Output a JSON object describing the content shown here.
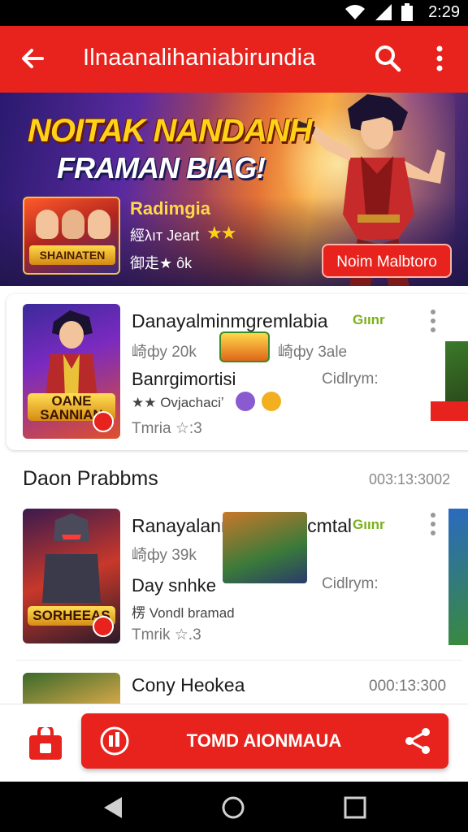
{
  "status_bar": {
    "time": "2:29",
    "icons": [
      "wifi-icon",
      "signal-icon",
      "battery-icon"
    ]
  },
  "app_bar": {
    "title": "Ilnaanalihaniabirundia",
    "icons": [
      "back-arrow-icon",
      "search-icon",
      "more-vert-icon"
    ]
  },
  "hero": {
    "headline_line1": "NOITAK NANDANH",
    "headline_line2": "FRAMAN BIAG!",
    "thumb_logo": "SHAINATEN",
    "game_name": "Radimgia",
    "meta": "經λıт Jeart",
    "stars": "★★",
    "sub": "御走★ ôk",
    "cta_label": "Noim Malbtoro"
  },
  "cards": [
    {
      "title": "Danayalminmgremlabia",
      "tag": "Gıınr",
      "meta_left": "崎фу  20k",
      "meta_right": "崎фу  3ale",
      "sub": "Banrgimortisi",
      "sub_right": "Cidlrym:",
      "small": "★★ Ovjachaciʼ",
      "tiny": "Tmria  ☆:3",
      "thumb_logo_line1": "OANE",
      "thumb_logo_line2": "SANNIAN"
    },
    {
      "title": "Ranayalanrnalanmallcmtal",
      "tag": "Gıınr",
      "meta_left": "崎фу  39k",
      "sub": "Day snhke",
      "sub_right": "Cidlrym:",
      "small": "楞 Vondl bramad",
      "tiny": "Tmrik  ☆.3",
      "thumb_logo_line1": "SORHEEAS",
      "thumb_logo_line2": ""
    },
    {
      "title": "Cony Heokea",
      "date": "000:13:300"
    }
  ],
  "section": {
    "title": "Daon Prabbms",
    "date": "003:13:3002"
  },
  "bottom_bar": {
    "primary_label": "TOMD AIONMAUA",
    "icons": [
      "store-icon",
      "badge-icon",
      "share-icon"
    ]
  },
  "nav_bar": {
    "icons": [
      "back-triangle-icon",
      "home-circle-icon",
      "recents-square-icon"
    ]
  },
  "colors": {
    "primary_red": "#e8221c",
    "star_yellow": "#ffd21a",
    "tag_green": "#7ab01a"
  }
}
